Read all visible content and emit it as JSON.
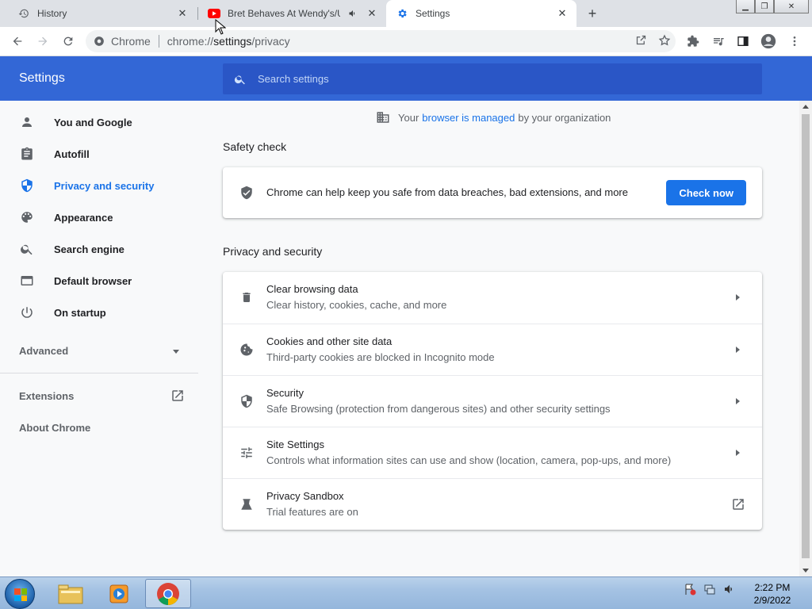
{
  "browser": {
    "tabs": [
      {
        "title": "History",
        "icon": "history-icon"
      },
      {
        "title": "Bret Behaves At Wendy's/Un",
        "icon": "youtube-icon",
        "audio": "speaker-icon"
      },
      {
        "title": "Settings",
        "icon": "settings-gear-icon"
      }
    ],
    "omnibox": {
      "site_chip": "Chrome",
      "url_host": "chrome://",
      "url_path": "settings",
      "url_rest": "/privacy"
    }
  },
  "settings": {
    "header_title": "Settings",
    "search_placeholder": "Search settings",
    "nav": [
      {
        "label": "You and Google",
        "icon": "person-icon"
      },
      {
        "label": "Autofill",
        "icon": "clipboard-icon"
      },
      {
        "label": "Privacy and security",
        "icon": "shield-icon",
        "active": true
      },
      {
        "label": "Appearance",
        "icon": "palette-icon"
      },
      {
        "label": "Search engine",
        "icon": "search-icon"
      },
      {
        "label": "Default browser",
        "icon": "browser-window-icon"
      },
      {
        "label": "On startup",
        "icon": "power-icon"
      }
    ],
    "advanced_label": "Advanced",
    "extensions_label": "Extensions",
    "about_label": "About Chrome",
    "managed": {
      "before": "Your",
      "link": "browser is managed",
      "after": "by your organization"
    },
    "safety_check": {
      "title": "Safety check",
      "text": "Chrome can help keep you safe from data breaches, bad extensions, and more",
      "button": "Check now"
    },
    "privacy_section": {
      "title": "Privacy and security",
      "rows": [
        {
          "primary": "Clear browsing data",
          "secondary": "Clear history, cookies, cache, and more",
          "icon": "trash-icon"
        },
        {
          "primary": "Cookies and other site data",
          "secondary": "Third-party cookies are blocked in Incognito mode",
          "icon": "cookie-icon"
        },
        {
          "primary": "Security",
          "secondary": "Safe Browsing (protection from dangerous sites) and other security settings",
          "icon": "security-shield-icon"
        },
        {
          "primary": "Site Settings",
          "secondary": "Controls what information sites can use and show (location, camera, pop-ups, and more)",
          "icon": "tune-sliders-icon"
        },
        {
          "primary": "Privacy Sandbox",
          "secondary": "Trial features are on",
          "icon": "flask-icon"
        }
      ]
    }
  },
  "taskbar": {
    "time": "2:22 PM",
    "date": "2/9/2022"
  },
  "colors": {
    "accent": "#1a73e8",
    "header": "#3367d6",
    "search_bg": "#2a56c6"
  }
}
